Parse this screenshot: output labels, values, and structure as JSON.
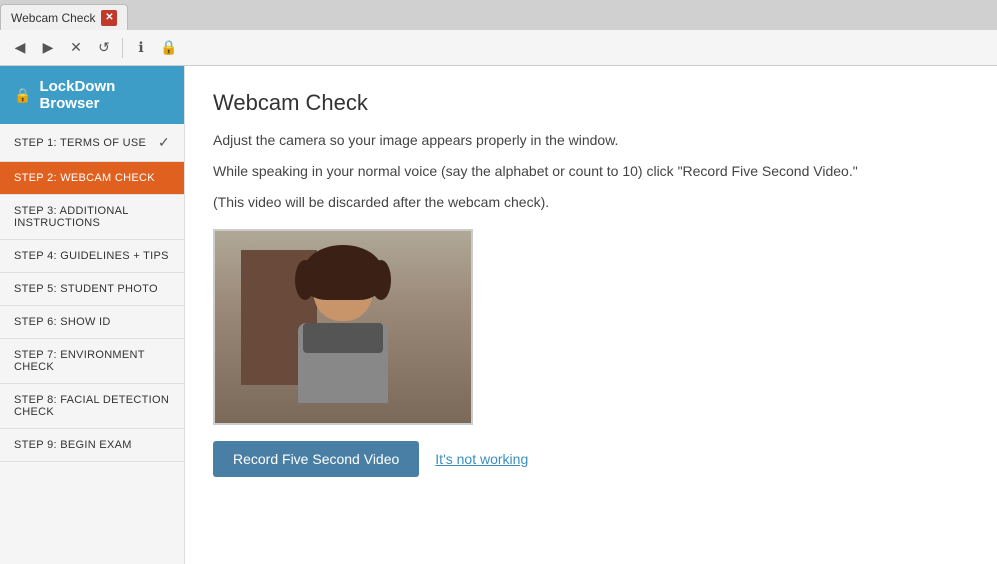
{
  "browser": {
    "tab_title": "Webcam Check",
    "close_label": "✕"
  },
  "nav": {
    "back_icon": "◀",
    "forward_icon": "▶",
    "close_icon": "✕",
    "refresh_icon": "↺",
    "info_icon": "ℹ",
    "shield_icon": "🔒"
  },
  "sidebar": {
    "header_title": "LockDown Browser",
    "lock_icon": "🔒",
    "items": [
      {
        "label": "STEP 1: TERMS OF USE",
        "active": false,
        "checked": true
      },
      {
        "label": "STEP 2: WEBCAM CHECK",
        "active": true,
        "checked": false
      },
      {
        "label": "STEP 3: ADDITIONAL INSTRUCTIONS",
        "active": false,
        "checked": false
      },
      {
        "label": "STEP 4: GUIDELINES + TIPS",
        "active": false,
        "checked": false
      },
      {
        "label": "STEP 5: STUDENT PHOTO",
        "active": false,
        "checked": false
      },
      {
        "label": "STEP 6: SHOW ID",
        "active": false,
        "checked": false
      },
      {
        "label": "STEP 7: ENVIRONMENT CHECK",
        "active": false,
        "checked": false
      },
      {
        "label": "STEP 8: FACIAL DETECTION CHECK",
        "active": false,
        "checked": false
      },
      {
        "label": "STEP 9: BEGIN EXAM",
        "active": false,
        "checked": false
      }
    ]
  },
  "main": {
    "page_title": "Webcam Check",
    "description_1": "Adjust the camera so your image appears properly in the window.",
    "description_2": "While speaking in your normal voice (say the alphabet or count to 10) click \"Record Five Second Video.\"",
    "description_3": "(This video will be discarded after the webcam check).",
    "record_button": "Record Five Second Video",
    "not_working_link": "It's not working"
  }
}
